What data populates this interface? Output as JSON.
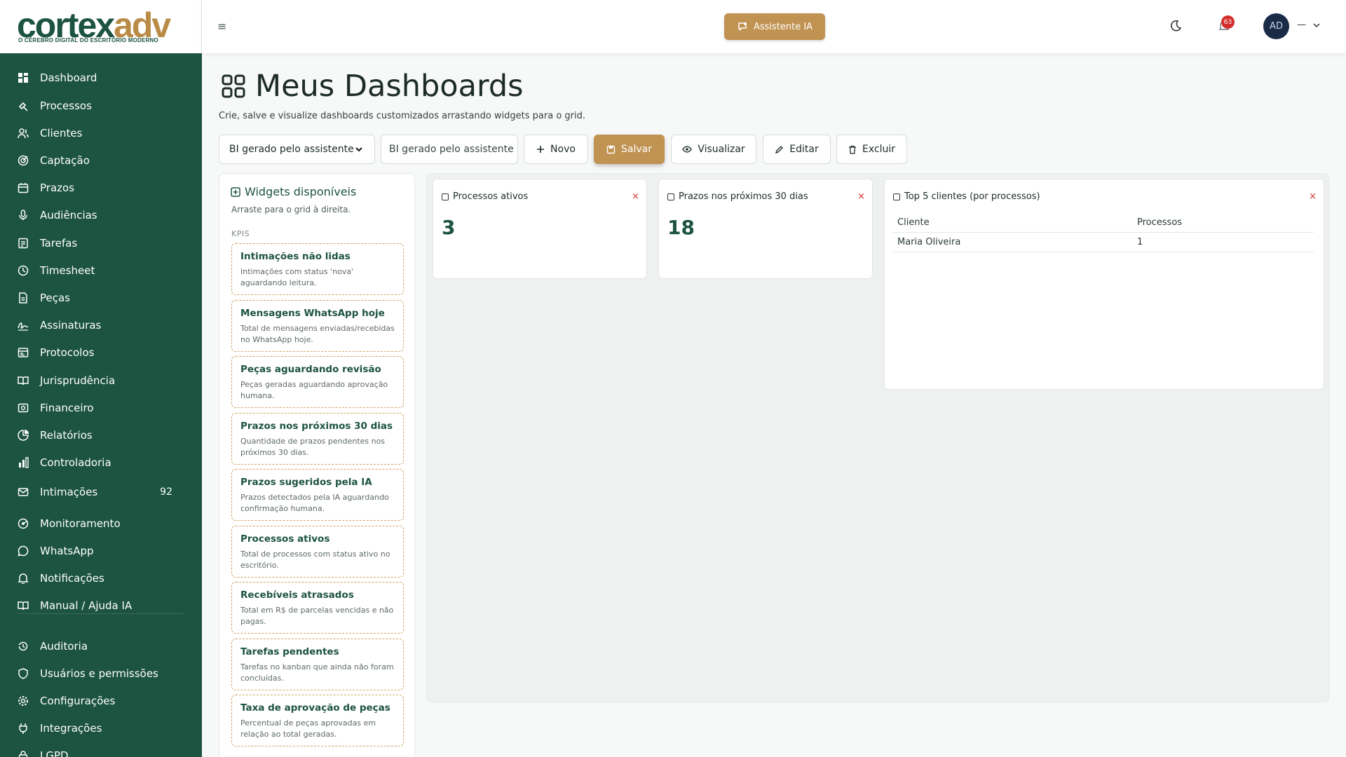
{
  "brand": {
    "logo_a": "cortex",
    "logo_b": "adv",
    "tagline": "O CÉREBRO DIGITAL DO ESCRITÓRIO MODERNO"
  },
  "topbar": {
    "ai_button": "Assistente IA",
    "notifications_count": "63",
    "avatar_initials": "AD",
    "user_name": "—"
  },
  "sidebar": {
    "items": [
      {
        "label": "Dashboard",
        "icon": "dashboard-icon"
      },
      {
        "label": "Processos",
        "icon": "gavel-icon"
      },
      {
        "label": "Clientes",
        "icon": "users-icon"
      },
      {
        "label": "Captação",
        "icon": "target-icon"
      },
      {
        "label": "Prazos",
        "icon": "calendar-icon"
      },
      {
        "label": "Audiências",
        "icon": "microphone-icon"
      },
      {
        "label": "Tarefas",
        "icon": "tasks-icon"
      },
      {
        "label": "Timesheet",
        "icon": "clock-icon"
      },
      {
        "label": "Peças",
        "icon": "document-icon"
      },
      {
        "label": "Assinaturas",
        "icon": "signature-icon"
      },
      {
        "label": "Protocolos",
        "icon": "protocol-icon"
      },
      {
        "label": "Jurisprudência",
        "icon": "book-icon"
      },
      {
        "label": "Financeiro",
        "icon": "money-icon"
      },
      {
        "label": "Relatórios",
        "icon": "pie-chart-icon"
      },
      {
        "label": "Controladoria",
        "icon": "bar-chart-icon"
      },
      {
        "label": "Intimações",
        "icon": "mail-icon",
        "badge": "92"
      },
      {
        "label": "Monitoramento",
        "icon": "radar-icon"
      },
      {
        "label": "WhatsApp",
        "icon": "whatsapp-icon"
      },
      {
        "label": "Notificações",
        "icon": "bell-icon"
      },
      {
        "label": "Manual / Ajuda IA",
        "icon": "manual-icon"
      },
      {
        "label": "Auditoria",
        "icon": "history-icon"
      },
      {
        "label": "Usuários e permissões",
        "icon": "shield-icon"
      },
      {
        "label": "Configurações",
        "icon": "gear-icon"
      },
      {
        "label": "Integrações",
        "icon": "plug-icon"
      },
      {
        "label": "LGPD",
        "icon": "lock-icon"
      }
    ]
  },
  "page": {
    "title": "Meus Dashboards",
    "subtitle": "Crie, salve e visualize dashboards customizados arrastando widgets para o grid."
  },
  "toolbar": {
    "select_value": "BI gerado pelo assistente",
    "name_value": "BI gerado pelo assistente",
    "novo": "Novo",
    "salvar": "Salvar",
    "visualizar": "Visualizar",
    "editar": "Editar",
    "excluir": "Excluir"
  },
  "widgets_panel": {
    "title": "Widgets disponíveis",
    "subtitle": "Arraste para o grid à direita.",
    "section": "KPIS",
    "items": [
      {
        "title": "Intimações não lidas",
        "desc": "Intimações com status 'nova' aguardando leitura."
      },
      {
        "title": "Mensagens WhatsApp hoje",
        "desc": "Total de mensagens enviadas/recebidas no WhatsApp hoje."
      },
      {
        "title": "Peças aguardando revisão",
        "desc": "Peças geradas aguardando aprovação humana."
      },
      {
        "title": "Prazos nos próximos 30 dias",
        "desc": "Quantidade de prazos pendentes nos próximos 30 dias."
      },
      {
        "title": "Prazos sugeridos pela IA",
        "desc": "Prazos detectados pela IA aguardando confirmação humana."
      },
      {
        "title": "Processos ativos",
        "desc": "Total de processos com status ativo no escritório."
      },
      {
        "title": "Recebíveis atrasados",
        "desc": "Total em R$ de parcelas vencidas e não pagas."
      },
      {
        "title": "Tarefas pendentes",
        "desc": "Tarefas no kanban que ainda não foram concluídas."
      },
      {
        "title": "Taxa de aprovação de peças",
        "desc": "Percentual de peças aprovadas em relação ao total geradas."
      }
    ]
  },
  "grid": {
    "cards": [
      {
        "title": "Processos ativos",
        "value": "3",
        "close": "×"
      },
      {
        "title": "Prazos nos próximos 30 dias",
        "value": "18",
        "close": "×"
      }
    ],
    "table_card": {
      "title": "Top 5 clientes (por processos)",
      "close": "×",
      "columns": [
        "Cliente",
        "Processos"
      ],
      "rows": [
        [
          "Maria Oliveira",
          "1"
        ]
      ]
    }
  },
  "colors": {
    "sidebar": "#1c5341",
    "accent": "#c09352",
    "danger": "#d32f2f"
  }
}
